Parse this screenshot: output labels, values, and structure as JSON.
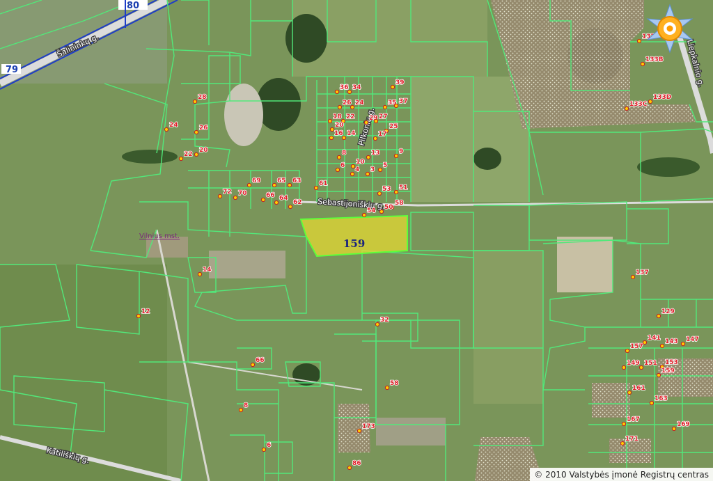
{
  "map": {
    "copyright": "© 2010 Valstybės įmonė Registrų centras",
    "area_label": "Vilnius mst.",
    "selected_parcel": {
      "label": "159",
      "color": "#f0e01e"
    },
    "road_numbers": [
      "80",
      "79"
    ],
    "streets": {
      "salininku": "Šalininkų g.",
      "sebastijoniskiu": "Sebastijoniškių g.",
      "pilkonio": "Pilkonių g.",
      "kalniskiu": "Katiliškių g.",
      "liepkalnio": "Liepkalnio g."
    },
    "house_numbers": [
      "32",
      "34",
      "39",
      "26",
      "24",
      "35",
      "37",
      "18",
      "22",
      "29",
      "27",
      "20",
      "25",
      "16",
      "14",
      "17",
      "8",
      "13",
      "9",
      "10",
      "6",
      "4",
      "3",
      "5",
      "61",
      "53",
      "51",
      "69",
      "65",
      "63",
      "72",
      "70",
      "66",
      "64",
      "62",
      "58",
      "54",
      "50",
      "28",
      "26",
      "24",
      "22",
      "20",
      "12",
      "14",
      "32",
      "8",
      "6",
      "66",
      "86",
      "137",
      "133B",
      "133C",
      "133D",
      "137",
      "129",
      "157",
      "141",
      "143",
      "147",
      "149",
      "151",
      "153",
      "159",
      "161",
      "163",
      "167",
      "169",
      "171",
      "173",
      "58",
      "36"
    ],
    "colors": {
      "parcel_border": "#52e87a",
      "road_border": "#1e3cc8",
      "selected_fill": "#e8dc30",
      "label_red": "#e0202a"
    },
    "icons": [
      "compass-icon",
      "house-marker-icon"
    ]
  }
}
